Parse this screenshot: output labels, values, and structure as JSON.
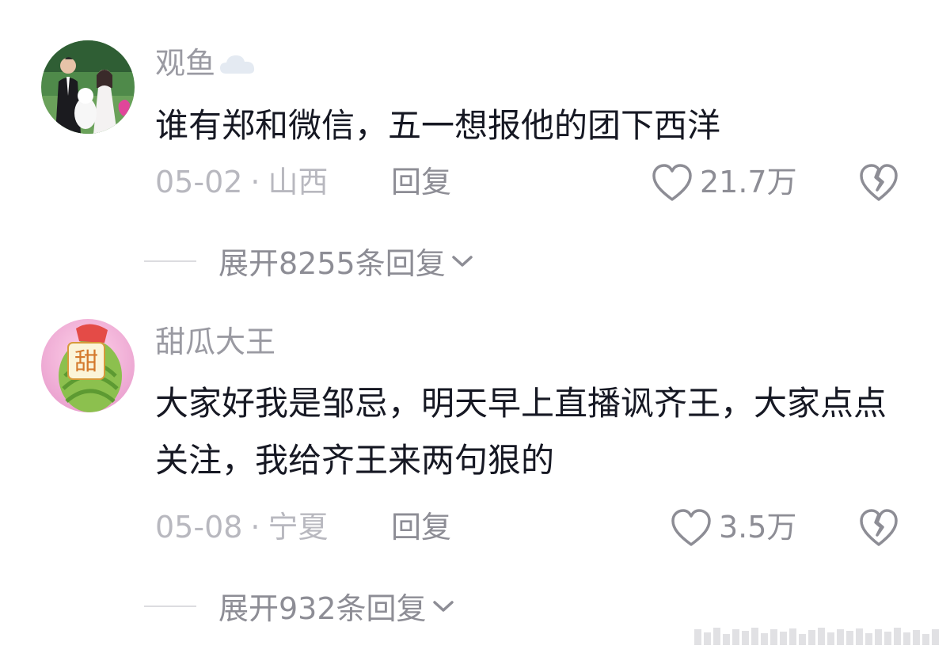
{
  "comments": [
    {
      "username": "观鱼",
      "user_icon": "cloud-icon",
      "text": "谁有郑和微信，五一想报他的团下西洋",
      "date": "05-02",
      "location": "山西",
      "reply_label": "回复",
      "likes": "21.7万",
      "expand_label": "展开8255条回复"
    },
    {
      "username": "甜瓜大王",
      "text": "大家好我是邹忌，明天早上直播讽齐王，大家点点关注，我给齐王来两句狠的",
      "date": "05-08",
      "location": "宁夏",
      "reply_label": "回复",
      "likes": "3.5万",
      "expand_label": "展开932条回复"
    }
  ],
  "meta_separator": "·",
  "avatar2_badge": "甜",
  "colors": {
    "username": "#9a9aa2",
    "text": "#161823",
    "meta": "#b8b8bf",
    "action": "#8d8d95"
  }
}
